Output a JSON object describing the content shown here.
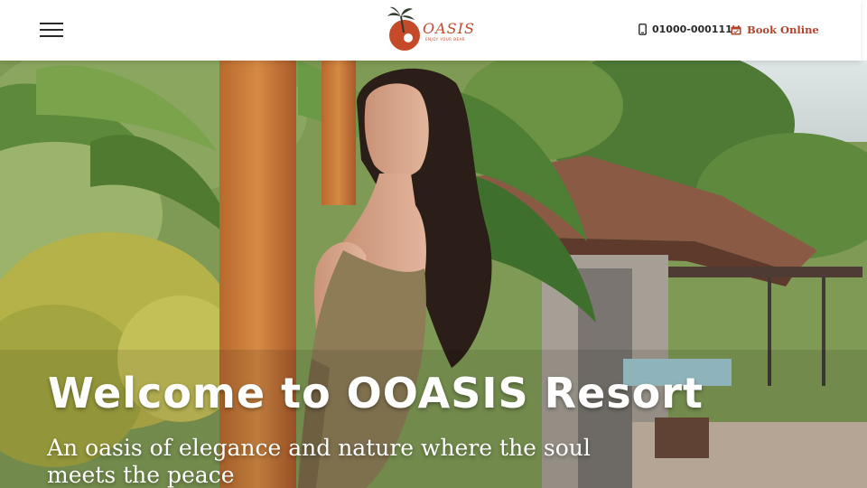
{
  "header": {
    "menu_icon": "hamburger-menu-icon",
    "logo": {
      "name": "OASIS",
      "tagline": "ENJOY YOUR BEAR",
      "icon": "palm-sun-logo-icon"
    },
    "phone": {
      "icon": "mobile-phone-icon",
      "number": "01000-000111"
    },
    "book": {
      "icon": "calendar-icon",
      "label": "Book Online"
    }
  },
  "hero": {
    "title": "Welcome to OOASIS Resort",
    "subtitle": "An oasis of elegance and nature where the soul meets the peace"
  },
  "colors": {
    "accent": "#b5432a",
    "logo_orange": "#c44a2a",
    "text_dark": "#2a2a2a",
    "hero_text": "#ffffff"
  }
}
